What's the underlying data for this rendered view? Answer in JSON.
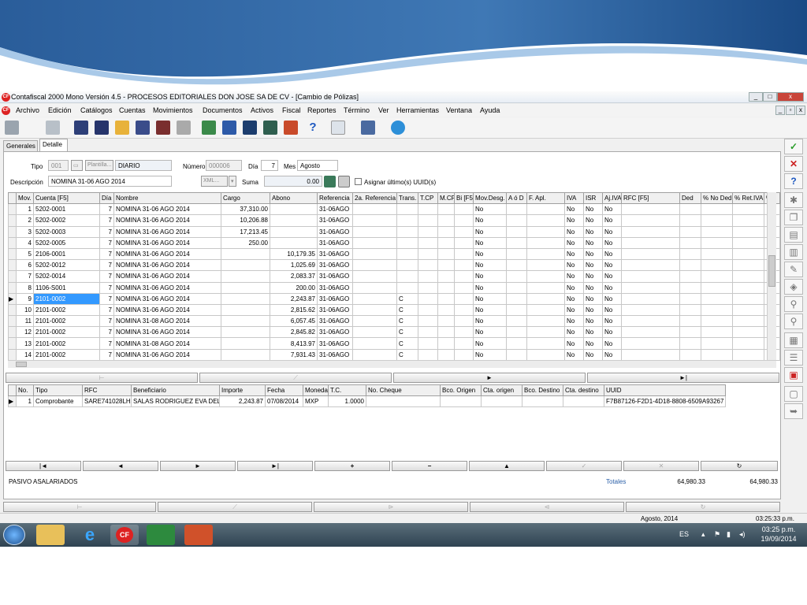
{
  "window": {
    "title": "Contafiscal 2000 Mono Versión 4.5 - PROCESOS EDITORIALES DON JOSE SA DE CV - [Cambio de Pólizas]",
    "app_icon_text": "CF",
    "min": "_",
    "max": "□",
    "close": "x",
    "inner_min": "_",
    "inner_max": "▫",
    "inner_close": "x"
  },
  "menu": [
    "Archivo",
    "Edición",
    "Catálogos",
    "Cuentas",
    "Movimientos",
    "Documentos",
    "Activos",
    "Fiscal",
    "Reportes",
    "Término",
    "Ver",
    "Herramientas",
    "Ventana",
    "Ayuda"
  ],
  "tabs": {
    "generales": "Generales",
    "detalle": "Detalle"
  },
  "header": {
    "tipo_label": "Tipo",
    "tipo_value": "001",
    "plantilla_label": "Plantilla...",
    "tipo_name": "DIARIO",
    "numero_label": "Número",
    "numero_value": "000006",
    "dia_label": "Día",
    "dia_value": "7",
    "mes_label": "Mes",
    "mes_value": "Agosto",
    "descripcion_label": "Descripción",
    "descripcion_value": "NOMINA 31-06 AGO 2014",
    "xml_label": "XML...",
    "suma_label": "Suma",
    "suma_value": "0.00",
    "asignar_label": "Asignar último(s) UUID(s)"
  },
  "grid1": {
    "columns": [
      "Mov.",
      "Cuenta  [F5]",
      "Día",
      "Nombre",
      "Cargo",
      "Abono",
      "Referencia",
      "2a. Referencia",
      "Trans.",
      "T.CP",
      "M.CP",
      "Bi [F5]",
      "Mov.Desg.",
      "A ó D",
      "F. Apl.",
      "IVA",
      "ISR",
      "Aj.IVA",
      "RFC  [F5]",
      "Ded",
      "% No Ded",
      "% Ret.IVA",
      "% I"
    ],
    "rows": [
      [
        "1",
        "5202-0001",
        "7",
        "NOMINA 31-06 AGO 2014",
        "37,310.00",
        "",
        "31-06AGO",
        "",
        "",
        "",
        "",
        "",
        "No",
        "",
        "",
        "No",
        "No",
        "No",
        "",
        "",
        "",
        "",
        ""
      ],
      [
        "2",
        "5202-0002",
        "7",
        "NOMINA 31-06 AGO 2014",
        "10,206.88",
        "",
        "31-06AGO",
        "",
        "",
        "",
        "",
        "",
        "No",
        "",
        "",
        "No",
        "No",
        "No",
        "",
        "",
        "",
        "",
        ""
      ],
      [
        "3",
        "5202-0003",
        "7",
        "NOMINA 31-06 AGO 2014",
        "17,213.45",
        "",
        "31-06AGO",
        "",
        "",
        "",
        "",
        "",
        "No",
        "",
        "",
        "No",
        "No",
        "No",
        "",
        "",
        "",
        "",
        ""
      ],
      [
        "4",
        "5202-0005",
        "7",
        "NOMINA 31-06 AGO 2014",
        "250.00",
        "",
        "31-06AGO",
        "",
        "",
        "",
        "",
        "",
        "No",
        "",
        "",
        "No",
        "No",
        "No",
        "",
        "",
        "",
        "",
        ""
      ],
      [
        "5",
        "2106-0001",
        "7",
        "NOMINA 31-06 AGO 2014",
        "",
        "10,179.35",
        "31-06AGO",
        "",
        "",
        "",
        "",
        "",
        "No",
        "",
        "",
        "No",
        "No",
        "No",
        "",
        "",
        "",
        "",
        ""
      ],
      [
        "6",
        "5202-0012",
        "7",
        "NOMINA 31-06 AGO 2014",
        "",
        "1,025.69",
        "31-06AGO",
        "",
        "",
        "",
        "",
        "",
        "No",
        "",
        "",
        "No",
        "No",
        "No",
        "",
        "",
        "",
        "",
        ""
      ],
      [
        "7",
        "5202-0014",
        "7",
        "NOMINA 31-06 AGO 2014",
        "",
        "2,083.37",
        "31-06AGO",
        "",
        "",
        "",
        "",
        "",
        "No",
        "",
        "",
        "No",
        "No",
        "No",
        "",
        "",
        "",
        "",
        ""
      ],
      [
        "8",
        "1106-S001",
        "7",
        "NOMINA 31-06 AGO 2014",
        "",
        "200.00",
        "31-06AGO",
        "",
        "",
        "",
        "",
        "",
        "No",
        "",
        "",
        "No",
        "No",
        "No",
        "",
        "",
        "",
        "",
        ""
      ],
      [
        "9",
        "2101-0002",
        "7",
        "NOMINA 31-06 AGO 2014",
        "",
        "2,243.87",
        "31-06AGO",
        "",
        "C",
        "",
        "",
        "",
        "No",
        "",
        "",
        "No",
        "No",
        "No",
        "",
        "",
        "",
        "",
        ""
      ],
      [
        "10",
        "2101-0002",
        "7",
        "NOMINA 31-06 AGO 2014",
        "",
        "2,815.62",
        "31-06AGO",
        "",
        "C",
        "",
        "",
        "",
        "No",
        "",
        "",
        "No",
        "No",
        "No",
        "",
        "",
        "",
        "",
        ""
      ],
      [
        "11",
        "2101-0002",
        "7",
        "NOMINA 31-08 AGO 2014",
        "",
        "6,057.45",
        "31-06AGO",
        "",
        "C",
        "",
        "",
        "",
        "No",
        "",
        "",
        "No",
        "No",
        "No",
        "",
        "",
        "",
        "",
        ""
      ],
      [
        "12",
        "2101-0002",
        "7",
        "NOMINA 31-06 AGO 2014",
        "",
        "2,845.82",
        "31-06AGO",
        "",
        "C",
        "",
        "",
        "",
        "No",
        "",
        "",
        "No",
        "No",
        "No",
        "",
        "",
        "",
        "",
        ""
      ],
      [
        "13",
        "2101-0002",
        "7",
        "NOMINA 31-08 AGO 2014",
        "",
        "8,413.97",
        "31-06AGO",
        "",
        "C",
        "",
        "",
        "",
        "No",
        "",
        "",
        "No",
        "No",
        "No",
        "",
        "",
        "",
        "",
        ""
      ],
      [
        "14",
        "2101-0002",
        "7",
        "NOMINA 31-06 AGO 2014",
        "",
        "7,931.43",
        "31-06AGO",
        "",
        "C",
        "",
        "",
        "",
        "No",
        "",
        "",
        "No",
        "No",
        "No",
        "",
        "",
        "",
        "",
        ""
      ]
    ]
  },
  "grid2": {
    "columns": [
      "No.",
      "Tipo",
      "RFC",
      "Beneficiario",
      "Importe",
      "Fecha",
      "Moneda",
      "T.C.",
      "No. Cheque",
      "Bco. Origen",
      "Cta. origen",
      "Bco. Destino",
      "Cta. destino",
      "UUID"
    ],
    "rows": [
      [
        "1",
        "Comprobante",
        "SARE741028LHA",
        "SALAS RODRIGUEZ EVA DEL",
        "2,243.87",
        "07/08/2014",
        "MXP",
        "1.0000",
        "",
        "",
        "",
        "",
        "",
        "F7B87126-F2D1-4D18-8808-6509A93267"
      ]
    ]
  },
  "nav": {
    "first": "|◄",
    "prev": "◄",
    "next": "►",
    "last": "►|",
    "add": "+",
    "remove": "−",
    "up": "▲",
    "check": "✓",
    "cancel": "✕",
    "refresh": "↻"
  },
  "nav_mid": {
    "play": "►",
    "end": "►|"
  },
  "status": {
    "cuenta": "PASIVO ASALARIADOS",
    "totales_label": "Totales",
    "total_cargo": "64,980.33",
    "total_abono": "64,980.33"
  },
  "footer": {
    "date": "Agosto, 2014",
    "time": "03:25:33 p.m."
  },
  "taskbar": {
    "lang": "ES",
    "clock_time": "03:25 p.m.",
    "clock_date": "19/09/2014",
    "app_cf": "CF"
  },
  "colors": {
    "accent": "#3399ff",
    "banner_dark": "#1d4f8c",
    "banner_light": "#9dc3e6",
    "taskbar": "#3c5060"
  }
}
